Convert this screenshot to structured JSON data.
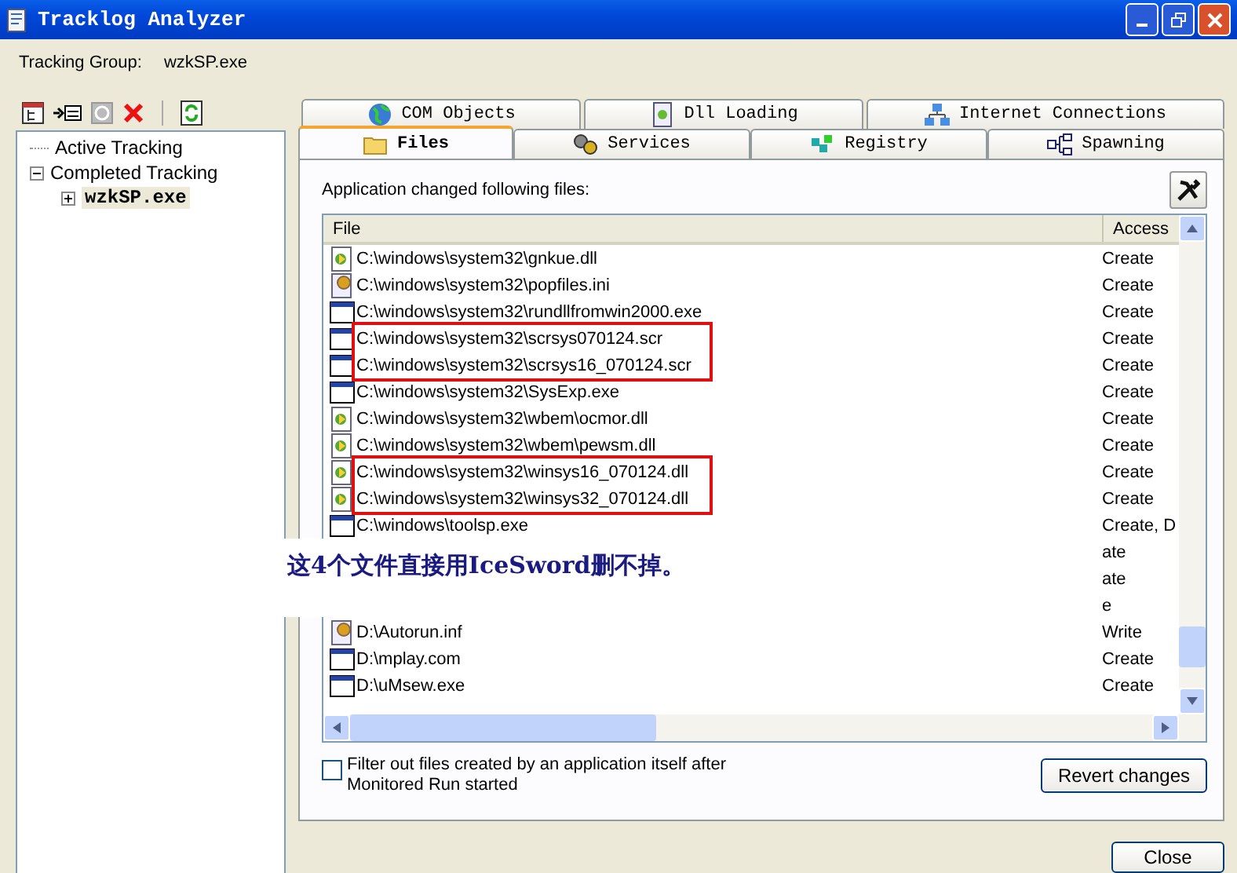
{
  "window": {
    "title": "Tracklog Analyzer"
  },
  "tracking_group": {
    "label": "Tracking Group:",
    "value": "wzkSP.exe"
  },
  "toolbar": [
    {
      "kind": "tree"
    },
    {
      "kind": "import"
    },
    {
      "kind": "stop",
      "disabled": true
    },
    {
      "kind": "delete"
    },
    {
      "kind": "refresh"
    }
  ],
  "tree": [
    {
      "label": "Active Tracking",
      "selected": false
    },
    {
      "label": "Completed Tracking",
      "selected": false,
      "expanded": true,
      "children": [
        {
          "label": "wzkSP.exe",
          "selected": true,
          "expanded": false
        }
      ]
    }
  ],
  "tabs_top": [
    {
      "label": "COM Objects"
    },
    {
      "label": "Dll Loading"
    },
    {
      "label": "Internet Connections"
    }
  ],
  "tabs_bottom": [
    {
      "label": "Files",
      "selected": true
    },
    {
      "label": "Services",
      "selected": false
    },
    {
      "label": "Registry",
      "selected": false
    },
    {
      "label": "Spawning",
      "selected": false
    }
  ],
  "caption": "Application changed following files:",
  "table": {
    "columns": [
      "File",
      "Access"
    ],
    "rows": [
      {
        "kind": "dll",
        "file": "C:\\windows\\system32\\gnkue.dll",
        "access": "Create",
        "highlighted": false
      },
      {
        "kind": "ini",
        "file": "C:\\windows\\system32\\popfiles.ini",
        "access": "Create",
        "highlighted": false
      },
      {
        "kind": "exe",
        "file": "C:\\windows\\system32\\rundllfromwin2000.exe",
        "access": "Create",
        "highlighted": false
      },
      {
        "kind": "exe",
        "file": "C:\\windows\\system32\\scrsys070124.scr",
        "access": "Create",
        "highlighted": true
      },
      {
        "kind": "exe",
        "file": "C:\\windows\\system32\\scrsys16_070124.scr",
        "access": "Create",
        "highlighted": true
      },
      {
        "kind": "exe",
        "file": "C:\\windows\\system32\\SysExp.exe",
        "access": "Create",
        "highlighted": false
      },
      {
        "kind": "dll",
        "file": "C:\\windows\\system32\\wbem\\ocmor.dll",
        "access": "Create",
        "highlighted": false
      },
      {
        "kind": "dll",
        "file": "C:\\windows\\system32\\wbem\\pewsm.dll",
        "access": "Create",
        "highlighted": false
      },
      {
        "kind": "dll",
        "file": "C:\\windows\\system32\\winsys16_070124.dll",
        "access": "Create",
        "highlighted": true
      },
      {
        "kind": "dll",
        "file": "C:\\windows\\system32\\winsys32_070124.dll",
        "access": "Create",
        "highlighted": true
      },
      {
        "kind": "exe",
        "file": "C:\\windows\\toolsp.exe",
        "access": "Create, D",
        "highlighted": false
      },
      {
        "kind": "covered",
        "access": "ate"
      },
      {
        "kind": "covered",
        "access": "ate"
      },
      {
        "kind": "covered",
        "access": "e"
      },
      {
        "kind": "ini",
        "file": "D:\\Autorun.inf",
        "access": "Write",
        "highlighted": false
      },
      {
        "kind": "exe",
        "file": "D:\\mplay.com",
        "access": "Create",
        "highlighted": false
      },
      {
        "kind": "exe",
        "file": "D:\\uMsew.exe",
        "access": "Create",
        "highlighted": false
      }
    ]
  },
  "note": "这4个文件直接用IceSword删不掉。",
  "filter": {
    "label": "Filter out files created by an application itself after Monitored Run started",
    "checked": false
  },
  "buttons": {
    "revert": "Revert changes",
    "close": "Close"
  }
}
